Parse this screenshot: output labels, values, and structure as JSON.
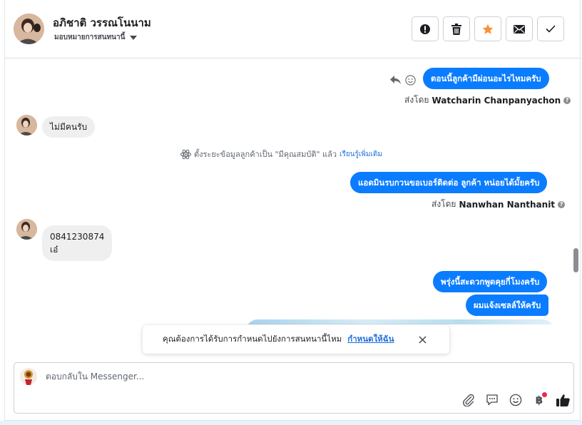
{
  "header": {
    "contact_name": "อภิชาติ วรรณโนนาม",
    "assign_label": "มอบหมายการสนทนานี้"
  },
  "messages": {
    "out1": "ตอนนี้ลูกค้ามีผ่อนอะไรไหมครับ",
    "out1_sent_prefix": "ส่งโดย",
    "out1_sender": "Watcharin Chanpanyachon",
    "in1": "ไม่มีคนรับ",
    "system_note": "ตั้งระยะข้อมูลลูกค้าเป็น \"มีคุณสมบัติ\" แล้ว",
    "system_link": "เรียนรู้เพิ่มเติม",
    "out2": "แอดมินรบกวนขอเบอร์ติดต่อ ลูกค้า หน่อยได้มั้ยครับ",
    "out2_sent_prefix": "ส่งโดย",
    "out2_sender": "Nanwhan Nanthanit",
    "in2_line1": "0841230874",
    "in2_line2": "เอ๋",
    "out3": "พรุ่งนี้สะดวกพูดคุยกี่โมงครับ",
    "out4": "ผมแจ้งเซลล์ให้ครับ"
  },
  "toast": {
    "text": "คุณต้องการได้รับการกำหนดไปยังการสนทนานี้ไหม",
    "link": "กำหนดให้ฉัน"
  },
  "composer": {
    "placeholder": "ตอบกลับใน Messenger...",
    "currency_symbol": "฿"
  },
  "colors": {
    "outgoing_bubble": "#0a7cff",
    "incoming_bubble": "#efefef",
    "star_accent": "#f7923a",
    "link": "#216fdb",
    "notification_dot": "#f02849"
  },
  "icons": {
    "actions": [
      "alert-icon",
      "trash-icon",
      "star-icon",
      "envelope-icon",
      "check-icon"
    ],
    "composer": [
      "paperclip-icon",
      "chat-bubble-icon",
      "emoji-icon",
      "baht-icon",
      "thumbs-up-icon"
    ]
  }
}
